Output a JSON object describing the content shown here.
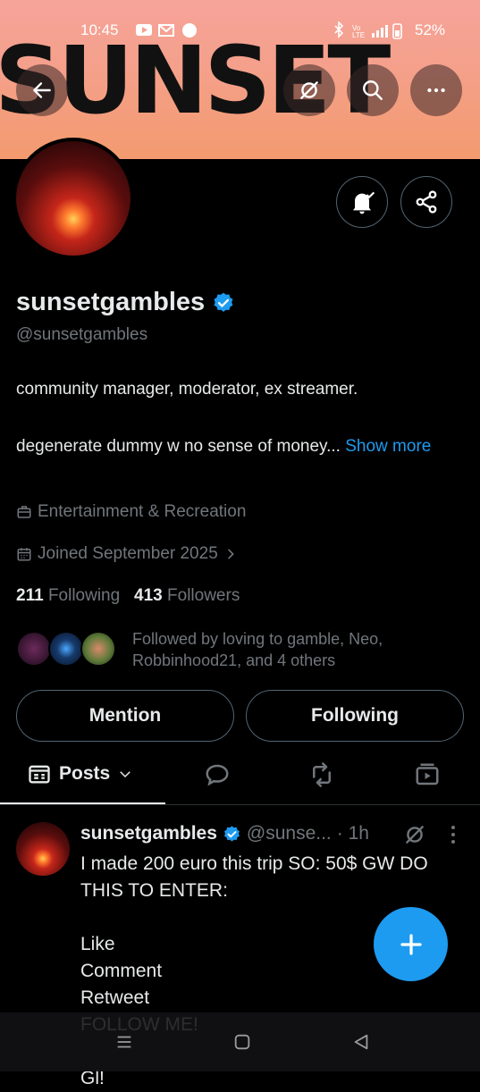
{
  "status_bar": {
    "time": "10:45",
    "battery": "52%",
    "network": "4G"
  },
  "banner": {
    "text": "SUNSET"
  },
  "profile": {
    "display_name": "sunsetgambles",
    "handle": "@sunsetgambles",
    "bio_line1": "community manager, moderator, ex streamer.",
    "bio_line2": "degenerate dummy w no sense of money...",
    "show_more": "Show more",
    "category": "Entertainment & Recreation",
    "joined": "Joined September 2025",
    "following_count": "211",
    "following_label": "Following",
    "followers_count": "413",
    "followers_label": "Followers",
    "followed_by": "Followed by loving to gamble, Neo, Robbinhood21, and 4 others"
  },
  "actions": {
    "mention": "Mention",
    "following": "Following"
  },
  "tabs": {
    "posts": "Posts"
  },
  "tweet": {
    "name": "sunsetgambles",
    "handle": "@sunse...",
    "time": "· 1h",
    "text": "I made 200 euro this trip SO: 50$ GW DO THIS TO ENTER:\n\nLike\nComment\nRetweet\nFOLLOW ME!\n\nGl!"
  },
  "colors": {
    "accent": "#1d9bf0",
    "background": "#000000",
    "muted": "#71767b"
  }
}
